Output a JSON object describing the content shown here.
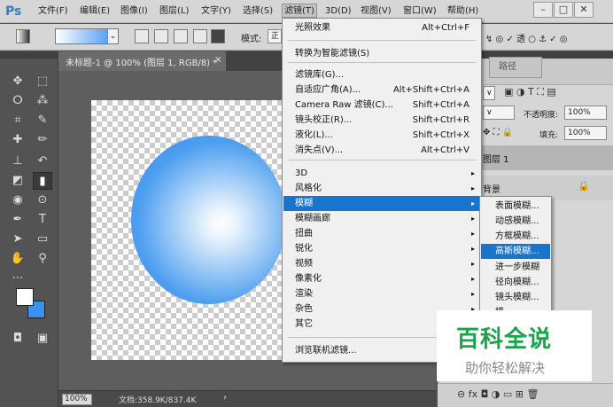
{
  "app": {
    "logo": "Ps"
  },
  "menubar": {
    "items": [
      "文件(F)",
      "编辑(E)",
      "图像(I)",
      "图层(L)",
      "文字(Y)",
      "选择(S)",
      "滤镜(T)",
      "3D(D)",
      "视图(V)",
      "窗口(W)",
      "帮助(H)"
    ],
    "window_controls": [
      "minimize-icon",
      "restore-icon",
      "close-icon"
    ]
  },
  "options": {
    "mode_label": "模式:",
    "mode_value": "正",
    "checkboxes": [
      "仿色",
      "透"
    ],
    "glyphs": {
      "gradient_dropdown": "⌄",
      "chevron": "∨",
      "mode_label": "模式:",
      "tools_trailing": "↯ ◎ ✓ 透 ○ ⚓ ✓ ◎"
    }
  },
  "document": {
    "tab_title": "未标题-1 @ 100% (图层 1, RGB/8) *",
    "tab_close": "×",
    "zoom": "100%",
    "doc_info": "文档:358.9K/837.4K",
    "status_arrow": "›"
  },
  "colors": {
    "foreground": "#ffffff",
    "background": "#3a91f2",
    "menu_highlight": "#1874cd",
    "gradient_end": "#3a91f2"
  },
  "tools": [
    {
      "icon": "move-icon",
      "glyph": "✥"
    },
    {
      "icon": "marquee-icon",
      "glyph": "⬚"
    },
    {
      "icon": "lasso-icon",
      "glyph": "ⵔ"
    },
    {
      "icon": "magic-wand-icon",
      "glyph": "⁂"
    },
    {
      "icon": "crop-icon",
      "glyph": "⌗"
    },
    {
      "icon": "eyedropper-icon",
      "glyph": "✎"
    },
    {
      "icon": "healing-brush-icon",
      "glyph": "✚"
    },
    {
      "icon": "brush-icon",
      "glyph": "✏"
    },
    {
      "icon": "clone-stamp-icon",
      "glyph": "⊥"
    },
    {
      "icon": "history-brush-icon",
      "glyph": "↶"
    },
    {
      "icon": "eraser-icon",
      "glyph": "◩"
    },
    {
      "icon": "gradient-icon",
      "glyph": "▮"
    },
    {
      "icon": "blur-icon",
      "glyph": "◉"
    },
    {
      "icon": "dodge-icon",
      "glyph": "⊙"
    },
    {
      "icon": "pen-icon",
      "glyph": "✒"
    },
    {
      "icon": "type-icon",
      "glyph": "T"
    },
    {
      "icon": "path-selection-icon",
      "glyph": "➤"
    },
    {
      "icon": "rectangle-icon",
      "glyph": "▭"
    },
    {
      "icon": "hand-icon",
      "glyph": "✋"
    },
    {
      "icon": "zoom-icon",
      "glyph": "⚲"
    },
    {
      "icon": "more-tools-icon",
      "glyph": "⋯"
    },
    {
      "icon": "quick-mask-icon",
      "glyph": "◘"
    },
    {
      "icon": "screen-mode-icon",
      "glyph": "▣"
    }
  ],
  "filter_menu": {
    "items": [
      {
        "label": "光照效果",
        "shortcut": "Alt+Ctrl+F"
      },
      {
        "label": "转换为智能滤镜(S)",
        "shortcut": ""
      },
      {
        "label": "滤镜库(G)...",
        "shortcut": ""
      },
      {
        "label": "自适应广角(A)...",
        "shortcut": "Alt+Shift+Ctrl+A"
      },
      {
        "label": "Camera Raw 滤镜(C)...",
        "shortcut": "Shift+Ctrl+A"
      },
      {
        "label": "镜头校正(R)...",
        "shortcut": "Shift+Ctrl+R"
      },
      {
        "label": "液化(L)...",
        "shortcut": "Shift+Ctrl+X"
      },
      {
        "label": "消失点(V)...",
        "shortcut": "Alt+Ctrl+V"
      },
      {
        "label": "3D",
        "shortcut": ""
      },
      {
        "label": "风格化",
        "shortcut": ""
      },
      {
        "label": "模糊",
        "shortcut": ""
      },
      {
        "label": "模糊画廊",
        "shortcut": ""
      },
      {
        "label": "扭曲",
        "shortcut": ""
      },
      {
        "label": "锐化",
        "shortcut": ""
      },
      {
        "label": "视频",
        "shortcut": ""
      },
      {
        "label": "像素化",
        "shortcut": ""
      },
      {
        "label": "渲染",
        "shortcut": ""
      },
      {
        "label": "杂色",
        "shortcut": ""
      },
      {
        "label": "其它",
        "shortcut": ""
      },
      {
        "label": "浏览联机滤镜...",
        "shortcut": ""
      }
    ],
    "submenu_arrow": "▸"
  },
  "blur_submenu": {
    "items": [
      "表面模糊...",
      "动感模糊...",
      "方框模糊...",
      "高斯模糊...",
      "进一步模糊",
      "径向模糊...",
      "镜头模糊...",
      "模..."
    ]
  },
  "panels": {
    "paths_tab": "路径",
    "opacity_label": "不透明度:",
    "opacity_value": "100%",
    "fill_label": "填充:",
    "fill_value": "100%",
    "layers": [
      {
        "name": "图层 1"
      },
      {
        "name": "背景"
      }
    ],
    "lock_icon": "🔒",
    "glyphs": {
      "topstrip": "‹‹",
      "kind_row": "▣ ◑ T ⛶ ▤",
      "lock_row": "✥ ⛶ 🔒",
      "dropdown": "∨",
      "bottom_icons": "⊖ fx ◘ ◑ ▭ ⊞ 🗑"
    }
  },
  "watermark": {
    "title": "百科全说",
    "subtitle": "助你轻松解决"
  }
}
